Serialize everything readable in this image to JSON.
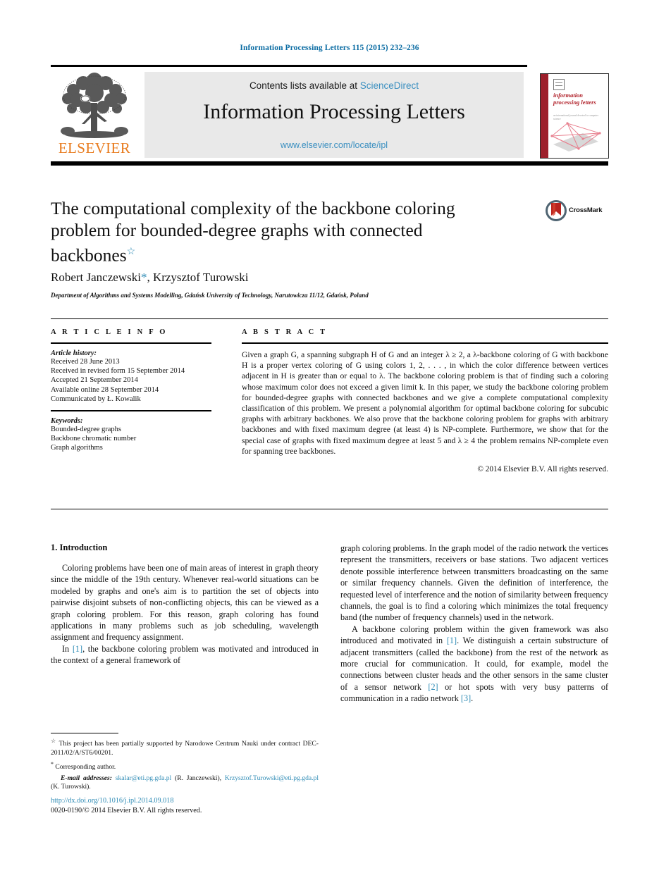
{
  "running_head": "Information Processing Letters 115 (2015) 232–236",
  "masthead": {
    "contents_prefix": "Contents lists available at ",
    "sciencedirect": "ScienceDirect",
    "journal_title": "Information Processing Letters",
    "url": "www.elsevier.com/locate/ipl",
    "publisher_wordmark": "ELSEVIER"
  },
  "cover": {
    "title": "information processing letters",
    "subtitle": "an international journal devoted to computer science"
  },
  "crossmark": {
    "label": "CrossMark"
  },
  "article": {
    "title": "The computational complexity of the backbone coloring problem for bounded-degree graphs with connected backbones",
    "title_footnote_mark": "☆",
    "authors": "Robert Janczewski",
    "authors_corr_mark": "*",
    "authors_rest": ", Krzysztof Turowski",
    "affiliation": "Department of Algorithms and Systems Modelling, Gdańsk University of Technology, Narutowicza 11/12, Gdańsk, Poland"
  },
  "info": {
    "heading": "A R T I C L E    I N F O",
    "history_label": "Article history:",
    "history": [
      "Received 28 June 2013",
      "Received in revised form 15 September 2014",
      "Accepted 21 September 2014",
      "Available online 28 September 2014",
      "Communicated by Ł. Kowalik"
    ],
    "keywords_label": "Keywords:",
    "keywords": [
      "Bounded-degree graphs",
      "Backbone chromatic number",
      "Graph algorithms"
    ]
  },
  "abstract": {
    "heading": "A B S T R A C T",
    "text": "Given a graph G, a spanning subgraph H of G and an integer λ ≥ 2, a λ-backbone coloring of G with backbone H is a proper vertex coloring of G using colors 1, 2, . . . , in which the color difference between vertices adjacent in H is greater than or equal to λ. The backbone coloring problem is that of finding such a coloring whose maximum color does not exceed a given limit k. In this paper, we study the backbone coloring problem for bounded-degree graphs with connected backbones and we give a complete computational complexity classification of this problem. We present a polynomial algorithm for optimal backbone coloring for subcubic graphs with arbitrary backbones. We also prove that the backbone coloring problem for graphs with arbitrary backbones and with fixed maximum degree (at least 4) is NP-complete. Furthermore, we show that for the special case of graphs with fixed maximum degree at least 5 and λ ≥ 4 the problem remains NP-complete even for spanning tree backbones.",
    "copyright": "© 2014 Elsevier B.V. All rights reserved."
  },
  "body": {
    "section_heading": "1. Introduction",
    "left_p1": "Coloring problems have been one of main areas of interest in graph theory since the middle of the 19th century. Whenever real-world situations can be modeled by graphs and one's aim is to partition the set of objects into pairwise disjoint subsets of non-conflicting objects, this can be viewed as a graph coloring problem. For this reason, graph coloring has found applications in many problems such as job scheduling, wavelength assignment and frequency assignment.",
    "left_p2_a": "In ",
    "left_p2_ref": "[1]",
    "left_p2_b": ", the backbone coloring problem was motivated and introduced in the context of a general framework of",
    "right_p1": "graph coloring problems. In the graph model of the radio network the vertices represent the transmitters, receivers or base stations. Two adjacent vertices denote possible interference between transmitters broadcasting on the same or similar frequency channels. Given the definition of interference, the requested level of interference and the notion of similarity between frequency channels, the goal is to find a coloring which minimizes the total frequency band (the number of frequency channels) used in the network.",
    "right_p2_a": "A backbone coloring problem within the given framework was also introduced and motivated in ",
    "right_p2_ref1": "[1]",
    "right_p2_b": ". We distinguish a certain substructure of adjacent transmitters (called the backbone) from the rest of the network as more crucial for communication. It could, for example, model the connections between cluster heads and the other sensors in the same cluster of a sensor network ",
    "right_p2_ref2": "[2]",
    "right_p2_c": " or hot spots with very busy patterns of communication in a radio network ",
    "right_p2_ref3": "[3]",
    "right_p2_d": "."
  },
  "footnotes": {
    "funding_mark": "☆",
    "funding": "This project has been partially supported by Narodowe Centrum Nauki under contract DEC-2011/02/A/ST6/00201.",
    "corresponding_mark": "*",
    "corresponding": "Corresponding author.",
    "email_label": "E-mail addresses:",
    "email1": "skalar@eti.pg.gda.pl",
    "email1_name": "(R. Janczewski),",
    "email2": "Krzysztof.Turowski@eti.pg.gda.pl",
    "email2_name": "(K. Turowski)."
  },
  "footer": {
    "doi": "http://dx.doi.org/10.1016/j.ipl.2014.09.018",
    "issn_line": "0020-0190/© 2014 Elsevier B.V. All rights reserved."
  },
  "colors": {
    "link_blue": "#2e8bb5",
    "masthead_link": "#3a8fc0",
    "elsevier_orange": "#e87b1e",
    "cover_red": "#9d1f2b",
    "running_head_blue": "#0b6ca3"
  }
}
